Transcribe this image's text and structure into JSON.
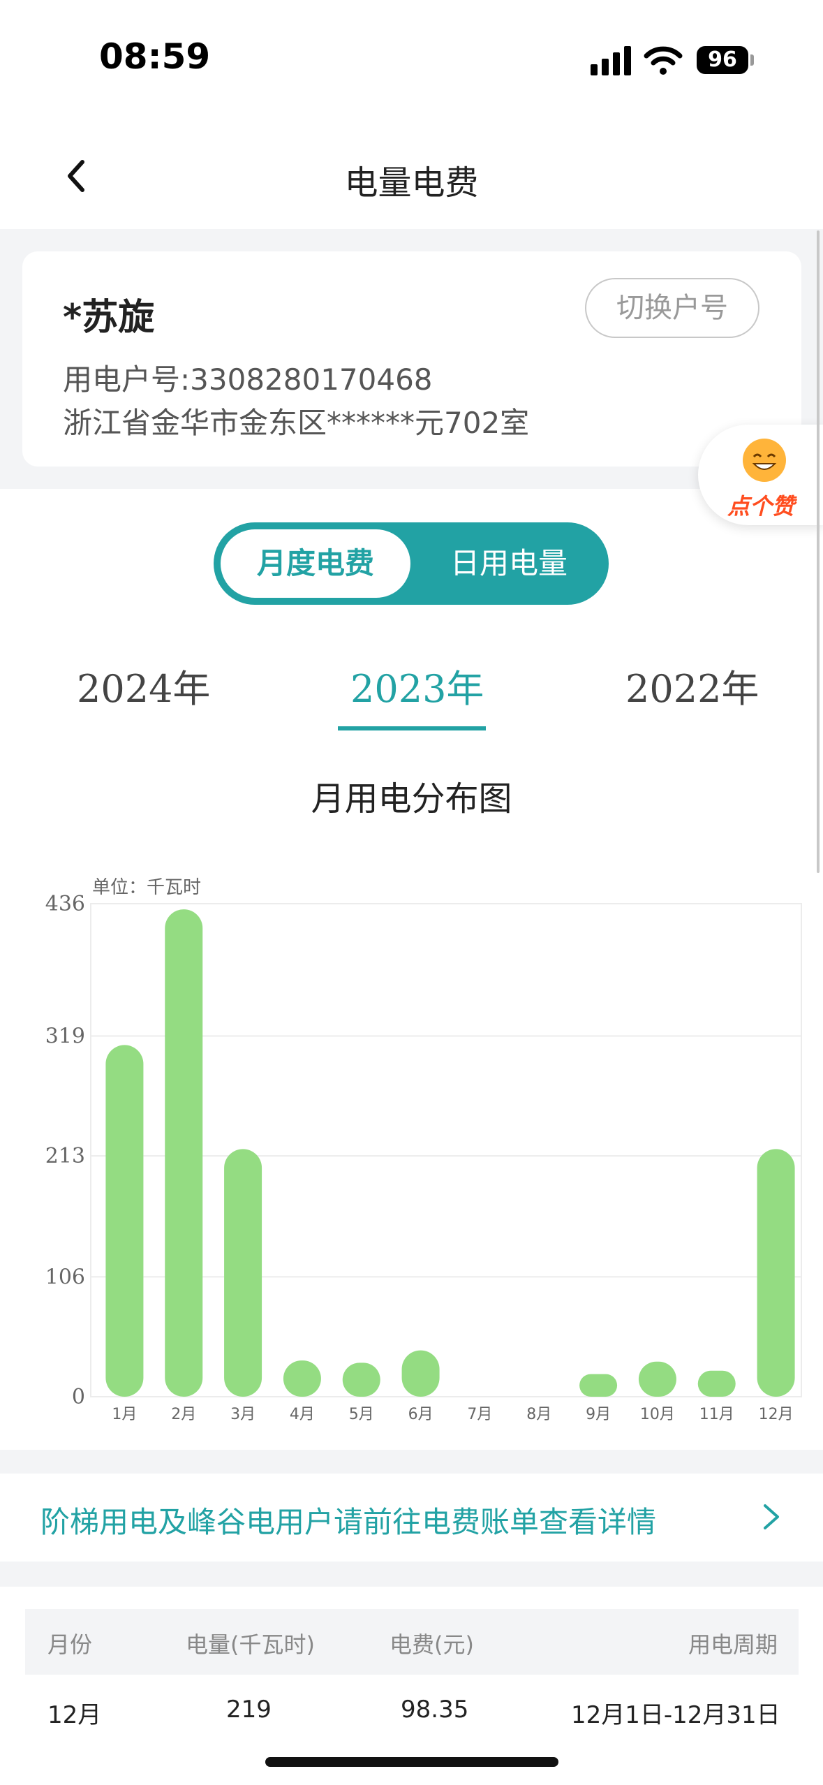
{
  "status": {
    "time": "08:59",
    "battery": "96"
  },
  "nav": {
    "title": "电量电费"
  },
  "account": {
    "name": "*苏旋",
    "switch_label": "切换户号",
    "number_line": "用电户号:3308280170468",
    "address": "浙江省金华市金东区******元702室"
  },
  "like_badge": {
    "label": "点个赞"
  },
  "toggle": {
    "option_monthly": "月度电费",
    "option_daily": "日用电量",
    "active": "月度电费"
  },
  "year_tabs": [
    {
      "label": "2024年"
    },
    {
      "label": "2023年",
      "active": true
    },
    {
      "label": "2022年"
    }
  ],
  "chart_title": "月用电分布图",
  "chart_data": {
    "type": "bar",
    "unit_label": "单位：千瓦时",
    "categories": [
      "1月",
      "2月",
      "3月",
      "4月",
      "5月",
      "6月",
      "7月",
      "8月",
      "9月",
      "10月",
      "11月",
      "12月"
    ],
    "values": [
      311,
      431,
      219,
      32,
      30,
      41,
      0,
      0,
      20,
      31,
      23,
      219
    ],
    "yticks": [
      "0",
      "106",
      "213",
      "319",
      "436"
    ],
    "ylim": [
      0,
      436
    ],
    "bar_color": "#94dc82"
  },
  "notice": {
    "text": "阶梯用电及峰谷电用户请前往电费账单查看详情"
  },
  "table": {
    "headers": [
      "月份",
      "电量(千瓦时)",
      "电费(元)",
      "用电周期"
    ],
    "rows": [
      [
        "12月",
        "219",
        "98.35",
        "12月1日-12月31日"
      ]
    ]
  },
  "colors": {
    "accent": "#22a2a4",
    "bar": "#94dc82"
  }
}
